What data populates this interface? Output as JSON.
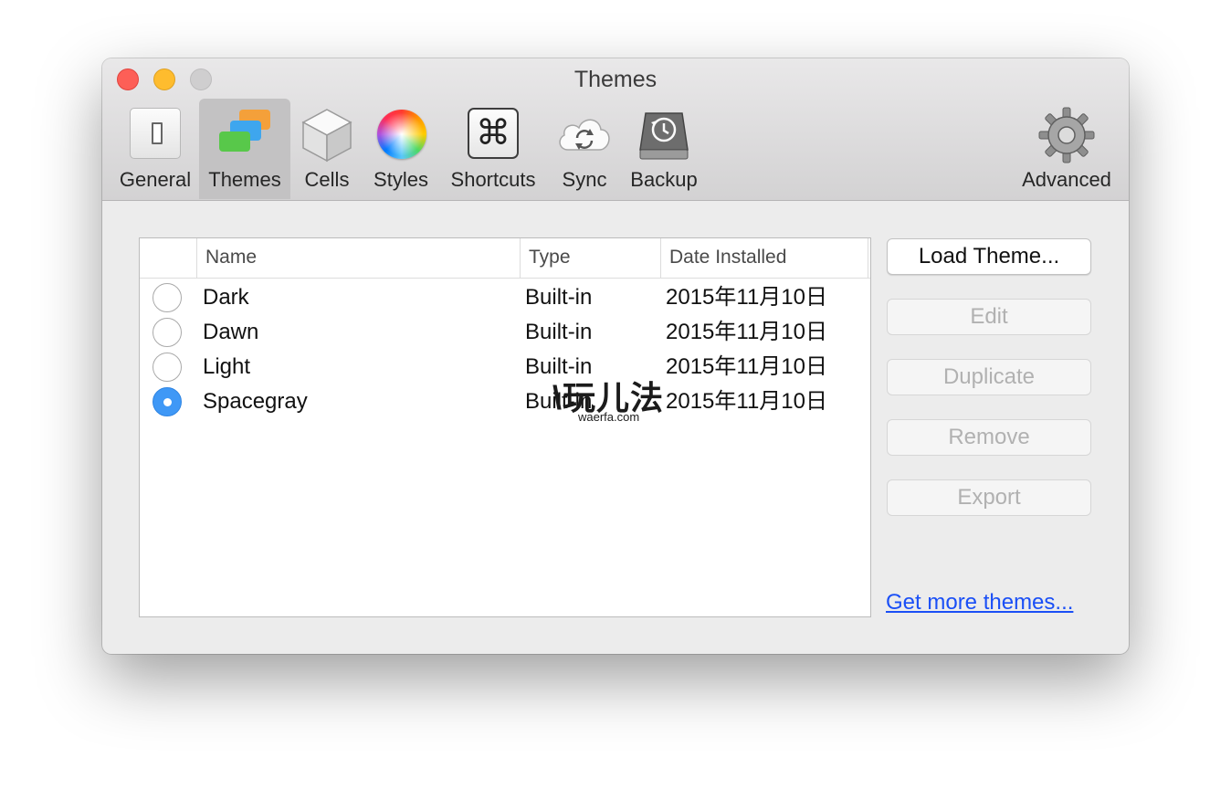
{
  "window": {
    "title": "Themes"
  },
  "toolbar": {
    "items": [
      {
        "label": "General",
        "icon": "general-switch-icon",
        "selected": false
      },
      {
        "label": "Themes",
        "icon": "themes-cards-icon",
        "selected": true
      },
      {
        "label": "Cells",
        "icon": "cells-cube-icon",
        "selected": false
      },
      {
        "label": "Styles",
        "icon": "styles-color-wheel-icon",
        "selected": false
      },
      {
        "label": "Shortcuts",
        "icon": "shortcuts-command-key-icon",
        "selected": false
      },
      {
        "label": "Sync",
        "icon": "sync-cloud-icon",
        "selected": false
      },
      {
        "label": "Backup",
        "icon": "backup-drive-icon",
        "selected": false
      },
      {
        "label": "Advanced",
        "icon": "advanced-gear-icon",
        "selected": false
      }
    ],
    "shortcut_glyph": "⌘"
  },
  "table": {
    "columns": {
      "name": "Name",
      "type": "Type",
      "date": "Date Installed"
    },
    "rows": [
      {
        "name": "Dark",
        "type": "Built-in",
        "date": "2015年11月10日",
        "selected": false
      },
      {
        "name": "Dawn",
        "type": "Built-in",
        "date": "2015年11月10日",
        "selected": false
      },
      {
        "name": "Light",
        "type": "Built-in",
        "date": "2015年11月10日",
        "selected": false
      },
      {
        "name": "Spacegray",
        "type": "Built-in",
        "date": "2015年11月10日",
        "selected": true
      }
    ]
  },
  "watermark": {
    "mark": "\\玩儿法",
    "site": "waerfa.com"
  },
  "actions": {
    "load": "Load Theme...",
    "edit": "Edit",
    "duplicate": "Duplicate",
    "remove": "Remove",
    "export": "Export"
  },
  "link": {
    "more_themes": "Get more themes..."
  },
  "colors": {
    "radio_selected": "#3f98f6",
    "link": "#1a4ff6",
    "close": "#fd5f57",
    "minimize": "#febc2e",
    "zoom": "#cfcecf"
  }
}
